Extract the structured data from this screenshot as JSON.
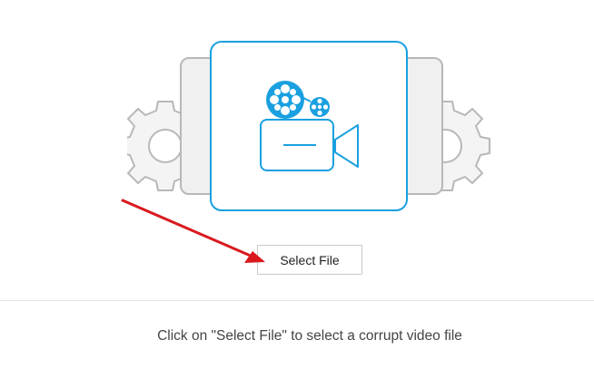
{
  "main": {
    "select_button_label": "Select File",
    "instruction_text": "Click on \"Select File\" to select a corrupt video file"
  },
  "icons": {
    "illustration": "video-camera-with-film-reel-icon",
    "gears": "gear-icon",
    "annotation": "red-arrow-icon"
  },
  "colors": {
    "accent": "#1aa0e0",
    "gear_gray": "#cfcfcf",
    "arrow_red": "#d9191e"
  }
}
